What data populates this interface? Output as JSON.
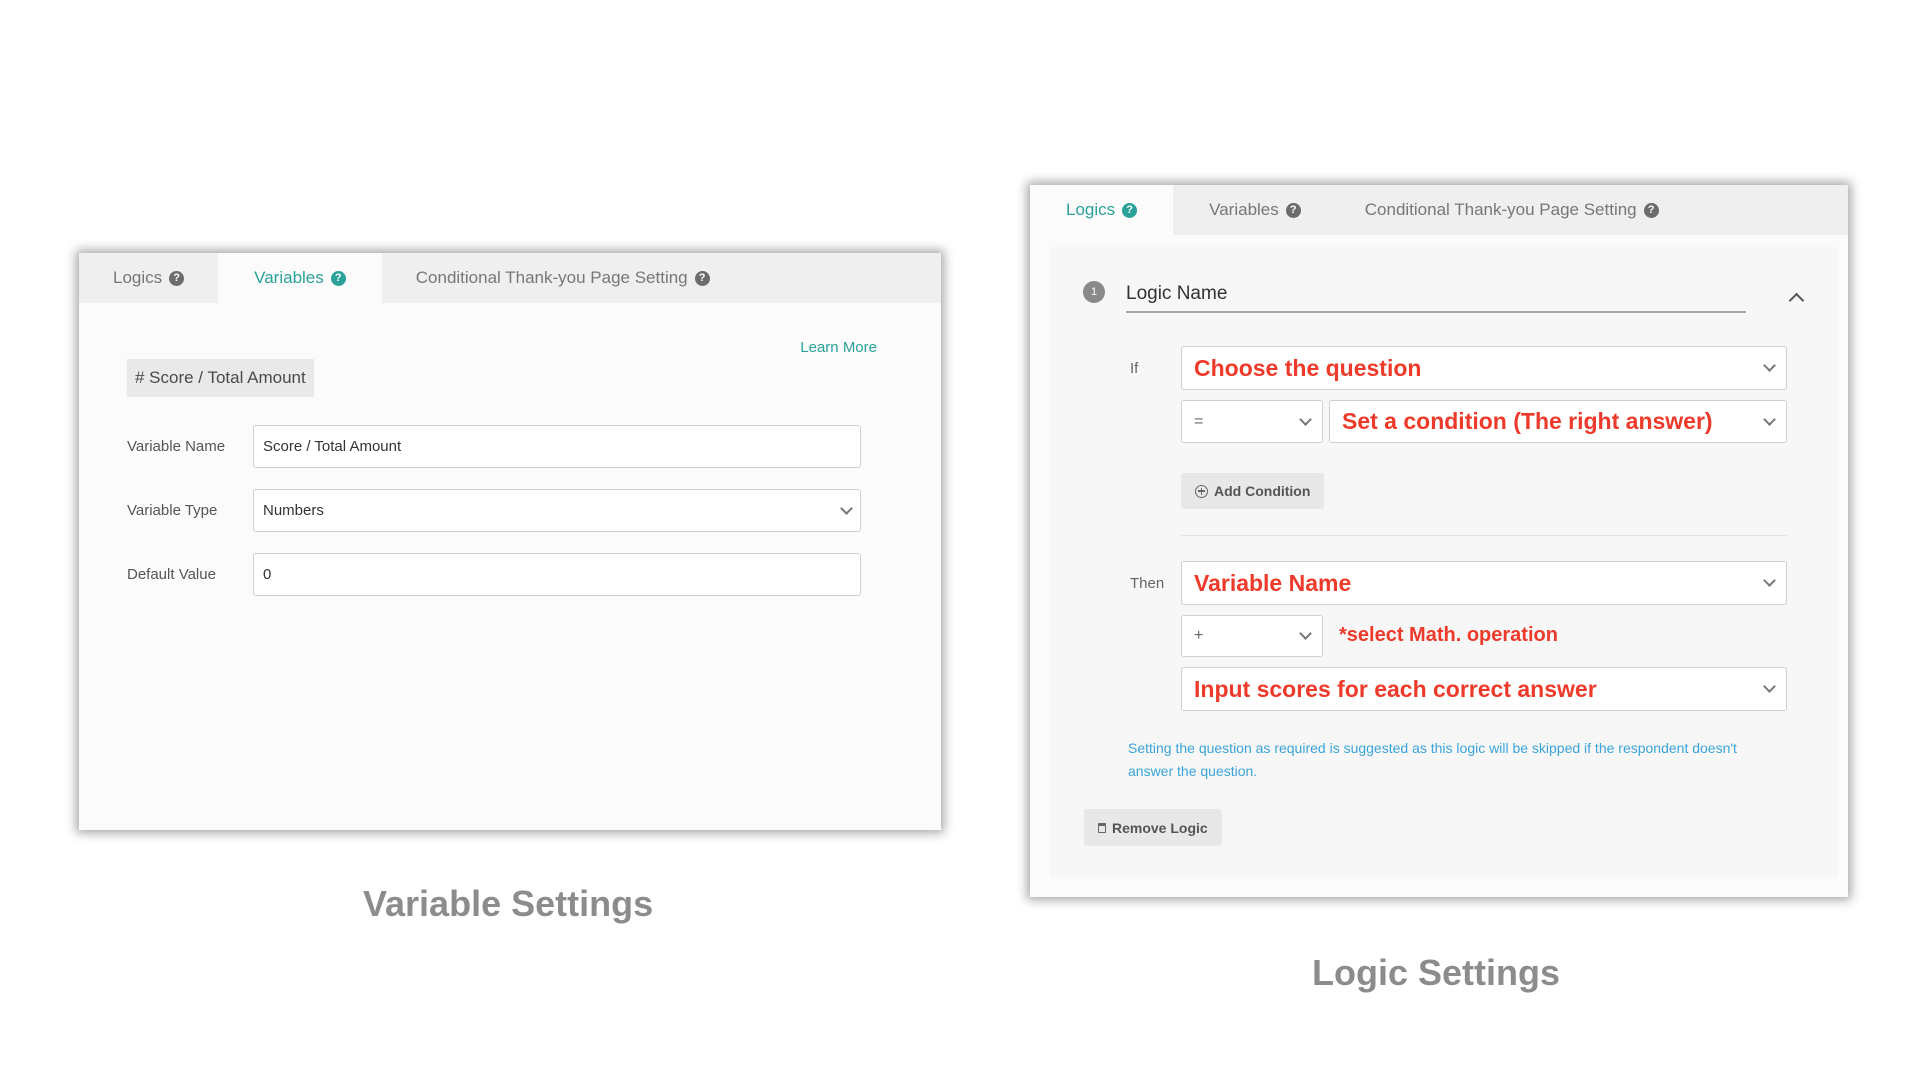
{
  "variable_panel": {
    "tabs": [
      {
        "label": "Logics",
        "icon": "question-circle-icon"
      },
      {
        "label": "Variables",
        "icon": "question-circle-icon"
      },
      {
        "label": "Conditional Thank-you Page Setting",
        "icon": "question-circle-icon"
      }
    ],
    "active_tab": "Variables",
    "learn_more": "Learn More",
    "variable_badge": "# Score / Total Amount",
    "fields": {
      "name": {
        "label": "Variable Name",
        "value": "Score / Total Amount"
      },
      "type": {
        "label": "Variable Type",
        "value": "Numbers"
      },
      "default": {
        "label": "Default Value",
        "value": "0"
      }
    },
    "caption": "Variable Settings"
  },
  "logic_panel": {
    "tabs": [
      {
        "label": "Logics",
        "icon": "question-circle-icon"
      },
      {
        "label": "Variables",
        "icon": "question-circle-icon"
      },
      {
        "label": "Conditional Thank-you Page Setting",
        "icon": "question-circle-icon"
      }
    ],
    "active_tab": "Logics",
    "step_number": "1",
    "logic_name": "Logic Name",
    "if_label": "If",
    "question_select": "Choose the question",
    "operator_select": "=",
    "condition_select": "Set a condition (The right answer)",
    "add_condition": "Add Condition",
    "then_label": "Then",
    "variable_select": "Variable Name",
    "math_operator_select": "+",
    "math_note": "*select Math. operation",
    "score_select": "Input scores for each correct answer",
    "hint_text": "Setting the question as required is suggested as this logic will be skipped if the respondent doesn't answer the question.",
    "remove_logic": "Remove Logic",
    "caption": "Logic Settings"
  },
  "colors": {
    "accent": "#2aa199",
    "annotation_red": "#ee3a2a",
    "hint_blue": "#3aa4d8"
  }
}
